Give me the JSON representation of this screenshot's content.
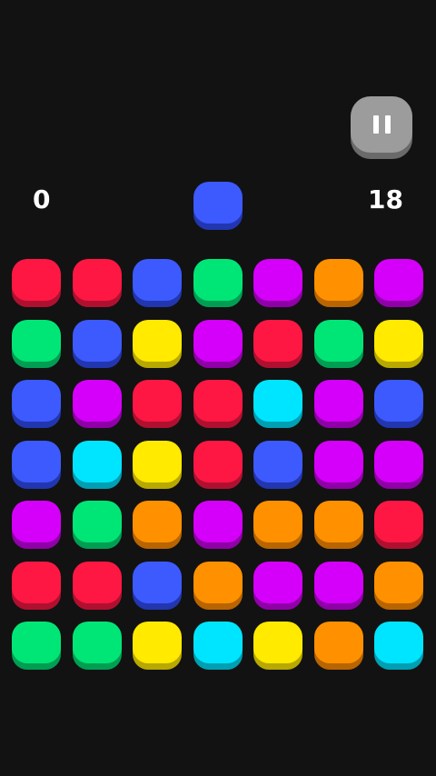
{
  "hud": {
    "score_left": "0",
    "score_right": "18",
    "target_color": "blue"
  },
  "pause_button": {
    "icon": "pause-icon"
  },
  "palette": {
    "red": {
      "top": "#ff1744",
      "side": "#b0102f"
    },
    "blue": {
      "top": "#3d5afe",
      "side": "#2236b0"
    },
    "green": {
      "top": "#00e676",
      "side": "#009e52"
    },
    "purple": {
      "top": "#d500f9",
      "side": "#9000a8"
    },
    "orange": {
      "top": "#ff9100",
      "side": "#b86400"
    },
    "yellow": {
      "top": "#ffea00",
      "side": "#b8a800"
    },
    "cyan": {
      "top": "#00e5ff",
      "side": "#009fb3"
    }
  },
  "board": {
    "rows": [
      [
        "red",
        "red",
        "blue",
        "green",
        "purple",
        "orange",
        "purple"
      ],
      [
        "green",
        "blue",
        "yellow",
        "purple",
        "red",
        "green",
        "yellow"
      ],
      [
        "blue",
        "purple",
        "red",
        "red",
        "cyan",
        "purple",
        "blue"
      ],
      [
        "blue",
        "cyan",
        "yellow",
        "red",
        "blue",
        "purple",
        "purple"
      ],
      [
        "purple",
        "green",
        "orange",
        "purple",
        "orange",
        "orange",
        "red"
      ],
      [
        "red",
        "red",
        "blue",
        "orange",
        "purple",
        "purple",
        "orange"
      ],
      [
        "green",
        "green",
        "yellow",
        "cyan",
        "yellow",
        "orange",
        "cyan"
      ]
    ]
  }
}
